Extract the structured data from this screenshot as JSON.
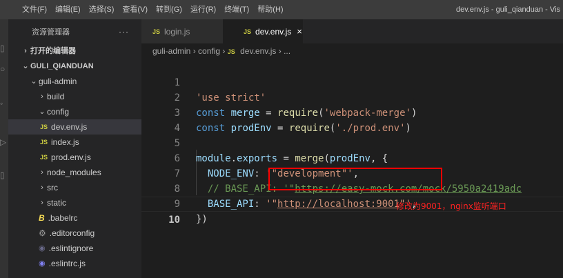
{
  "menubar": {
    "items": [
      "文件(F)",
      "编辑(E)",
      "选择(S)",
      "查看(V)",
      "转到(G)",
      "运行(R)",
      "终端(T)",
      "帮助(H)"
    ],
    "window_title": "dev.env.js - guli_qianduan - Vis"
  },
  "sidebar": {
    "title": "资源管理器",
    "more": "···",
    "open_editors": "打开的编辑器",
    "workspace": "GULI_QIANDUAN",
    "tree": {
      "guli_admin": "guli-admin",
      "build": "build",
      "config": "config",
      "dev_env": "dev.env.js",
      "index": "index.js",
      "prod_env": "prod.env.js",
      "node_modules": "node_modules",
      "src": "src",
      "static": "static",
      "babelrc": ".babelrc",
      "editorconfig": ".editorconfig",
      "eslintignore": ".eslintignore",
      "eslintrc": ".eslintrc.js"
    }
  },
  "tabs": [
    {
      "label": "login.js",
      "active": false
    },
    {
      "label": "dev.env.js",
      "active": true
    }
  ],
  "icons": {
    "js": "JS",
    "close": "×",
    "chevron_right": "›",
    "chevron_down": "⌄",
    "babel": "B",
    "gear": "⚙",
    "eslint": "◉"
  },
  "breadcrumb": {
    "root": "guli-admin",
    "folder": "config",
    "file": "dev.env.js",
    "ellipsis": "..."
  },
  "code": {
    "line_numbers": [
      "1",
      "2",
      "3",
      "4",
      "5",
      "6",
      "7",
      "8",
      "9",
      "10"
    ],
    "l1_str": "'use strict'",
    "l2_kw": "const",
    "l2_var": "merge",
    "l2_eq": " = ",
    "l2_fn": "require",
    "l2_open": "(",
    "l2_str": "'webpack-merge'",
    "l2_close": ")",
    "l3_kw": "const",
    "l3_var": "prodEnv",
    "l3_eq": " = ",
    "l3_fn": "require",
    "l3_open": "(",
    "l3_str": "'./prod.env'",
    "l3_close": ")",
    "l5_obj": "module",
    "l5_dot": ".",
    "l5_prop": "exports",
    "l5_eq": " = ",
    "l5_fn": "merge",
    "l5_open": "(",
    "l5_arg": "prodEnv",
    "l5_rest": ", {",
    "l6_key": "NODE_ENV",
    "l6_colon": ": ",
    "l6_str": "'\"development\"'",
    "l6_comma": ",",
    "l7_comment": "// BASE_API: '\"",
    "l7_link": "https://easy-mock.com/mock/5950a2419adc",
    "l8_key": "BASE_API",
    "l8_colon": ": ",
    "l8_q1": "'\"",
    "l8_link": "http://localhost:9001",
    "l8_q2": "\"'",
    "l8_comma": ",",
    "l9": "})"
  },
  "annotation": "修改为9001，nginx监听端口",
  "colors": {
    "annotation": "#ff2222",
    "highlight_box": "#ff0000",
    "editor_bg": "#1e1e1e",
    "sidebar_bg": "#252526"
  }
}
